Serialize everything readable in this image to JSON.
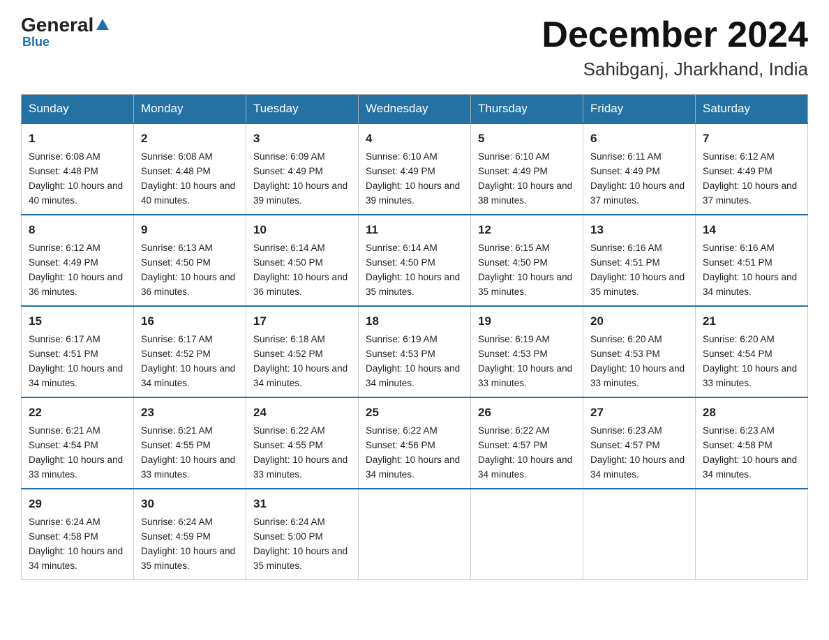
{
  "header": {
    "logo_general": "General",
    "logo_blue": "Blue",
    "main_title": "December 2024",
    "sub_title": "Sahibganj, Jharkhand, India"
  },
  "days_of_week": [
    "Sunday",
    "Monday",
    "Tuesday",
    "Wednesday",
    "Thursday",
    "Friday",
    "Saturday"
  ],
  "weeks": [
    [
      {
        "day": 1,
        "sunrise": "6:08 AM",
        "sunset": "4:48 PM",
        "daylight": "10 hours and 40 minutes."
      },
      {
        "day": 2,
        "sunrise": "6:08 AM",
        "sunset": "4:48 PM",
        "daylight": "10 hours and 40 minutes."
      },
      {
        "day": 3,
        "sunrise": "6:09 AM",
        "sunset": "4:49 PM",
        "daylight": "10 hours and 39 minutes."
      },
      {
        "day": 4,
        "sunrise": "6:10 AM",
        "sunset": "4:49 PM",
        "daylight": "10 hours and 39 minutes."
      },
      {
        "day": 5,
        "sunrise": "6:10 AM",
        "sunset": "4:49 PM",
        "daylight": "10 hours and 38 minutes."
      },
      {
        "day": 6,
        "sunrise": "6:11 AM",
        "sunset": "4:49 PM",
        "daylight": "10 hours and 37 minutes."
      },
      {
        "day": 7,
        "sunrise": "6:12 AM",
        "sunset": "4:49 PM",
        "daylight": "10 hours and 37 minutes."
      }
    ],
    [
      {
        "day": 8,
        "sunrise": "6:12 AM",
        "sunset": "4:49 PM",
        "daylight": "10 hours and 36 minutes."
      },
      {
        "day": 9,
        "sunrise": "6:13 AM",
        "sunset": "4:50 PM",
        "daylight": "10 hours and 36 minutes."
      },
      {
        "day": 10,
        "sunrise": "6:14 AM",
        "sunset": "4:50 PM",
        "daylight": "10 hours and 36 minutes."
      },
      {
        "day": 11,
        "sunrise": "6:14 AM",
        "sunset": "4:50 PM",
        "daylight": "10 hours and 35 minutes."
      },
      {
        "day": 12,
        "sunrise": "6:15 AM",
        "sunset": "4:50 PM",
        "daylight": "10 hours and 35 minutes."
      },
      {
        "day": 13,
        "sunrise": "6:16 AM",
        "sunset": "4:51 PM",
        "daylight": "10 hours and 35 minutes."
      },
      {
        "day": 14,
        "sunrise": "6:16 AM",
        "sunset": "4:51 PM",
        "daylight": "10 hours and 34 minutes."
      }
    ],
    [
      {
        "day": 15,
        "sunrise": "6:17 AM",
        "sunset": "4:51 PM",
        "daylight": "10 hours and 34 minutes."
      },
      {
        "day": 16,
        "sunrise": "6:17 AM",
        "sunset": "4:52 PM",
        "daylight": "10 hours and 34 minutes."
      },
      {
        "day": 17,
        "sunrise": "6:18 AM",
        "sunset": "4:52 PM",
        "daylight": "10 hours and 34 minutes."
      },
      {
        "day": 18,
        "sunrise": "6:19 AM",
        "sunset": "4:53 PM",
        "daylight": "10 hours and 34 minutes."
      },
      {
        "day": 19,
        "sunrise": "6:19 AM",
        "sunset": "4:53 PM",
        "daylight": "10 hours and 33 minutes."
      },
      {
        "day": 20,
        "sunrise": "6:20 AM",
        "sunset": "4:53 PM",
        "daylight": "10 hours and 33 minutes."
      },
      {
        "day": 21,
        "sunrise": "6:20 AM",
        "sunset": "4:54 PM",
        "daylight": "10 hours and 33 minutes."
      }
    ],
    [
      {
        "day": 22,
        "sunrise": "6:21 AM",
        "sunset": "4:54 PM",
        "daylight": "10 hours and 33 minutes."
      },
      {
        "day": 23,
        "sunrise": "6:21 AM",
        "sunset": "4:55 PM",
        "daylight": "10 hours and 33 minutes."
      },
      {
        "day": 24,
        "sunrise": "6:22 AM",
        "sunset": "4:55 PM",
        "daylight": "10 hours and 33 minutes."
      },
      {
        "day": 25,
        "sunrise": "6:22 AM",
        "sunset": "4:56 PM",
        "daylight": "10 hours and 34 minutes."
      },
      {
        "day": 26,
        "sunrise": "6:22 AM",
        "sunset": "4:57 PM",
        "daylight": "10 hours and 34 minutes."
      },
      {
        "day": 27,
        "sunrise": "6:23 AM",
        "sunset": "4:57 PM",
        "daylight": "10 hours and 34 minutes."
      },
      {
        "day": 28,
        "sunrise": "6:23 AM",
        "sunset": "4:58 PM",
        "daylight": "10 hours and 34 minutes."
      }
    ],
    [
      {
        "day": 29,
        "sunrise": "6:24 AM",
        "sunset": "4:58 PM",
        "daylight": "10 hours and 34 minutes."
      },
      {
        "day": 30,
        "sunrise": "6:24 AM",
        "sunset": "4:59 PM",
        "daylight": "10 hours and 35 minutes."
      },
      {
        "day": 31,
        "sunrise": "6:24 AM",
        "sunset": "5:00 PM",
        "daylight": "10 hours and 35 minutes."
      },
      null,
      null,
      null,
      null
    ]
  ]
}
